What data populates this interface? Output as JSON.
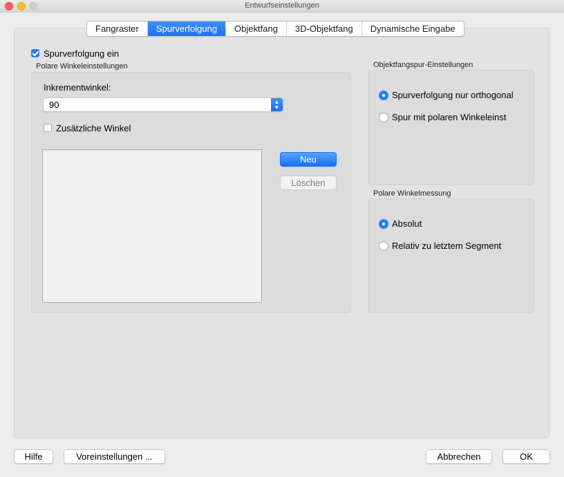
{
  "window": {
    "title": "Entwurfseinstellungen"
  },
  "tabs": [
    {
      "label": "Fangraster",
      "active": false
    },
    {
      "label": "Spurverfolgung",
      "active": true
    },
    {
      "label": "Objektfang",
      "active": false
    },
    {
      "label": "3D-Objektfang",
      "active": false
    },
    {
      "label": "Dynamische Eingabe",
      "active": false
    }
  ],
  "tracking": {
    "enable_label": "Spurverfolgung ein",
    "enabled": true
  },
  "polar": {
    "group_title": "Polare Winkeleinstellungen",
    "increment_label": "Inkrementwinkel:",
    "increment_value": "90",
    "additional_label": "Zusätzliche Winkel",
    "additional_checked": false,
    "new_button": "Neu",
    "delete_button": "Löschen"
  },
  "osnap_tracking": {
    "group_title": "Objektfangspur-Einstellungen",
    "options": [
      {
        "label": "Spurverfolgung nur orthogonal",
        "selected": true
      },
      {
        "label": "Spur mit polaren Winkeleinst",
        "selected": false
      }
    ]
  },
  "polar_measure": {
    "group_title": "Polare Winkelmessung",
    "options": [
      {
        "label": "Absolut",
        "selected": true
      },
      {
        "label": "Relativ zu letztem Segment",
        "selected": false
      }
    ]
  },
  "footer": {
    "help": "Hilfe",
    "defaults": "Voreinstellungen ...",
    "cancel": "Abbrechen",
    "ok": "OK"
  },
  "colors": {
    "accent": "#2a7df6",
    "window_bg": "#ececec",
    "panel_bg": "#e3e3e3"
  }
}
